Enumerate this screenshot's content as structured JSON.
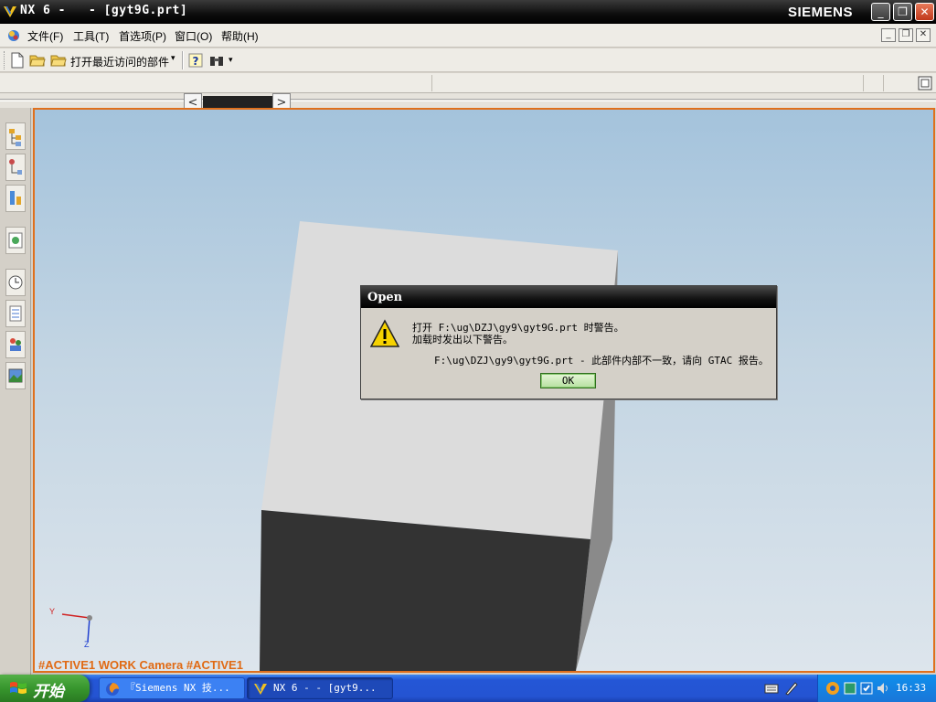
{
  "window": {
    "title": "NX 6 -   - [gyt9G.prt]",
    "brand": "SIEMENS"
  },
  "menu": {
    "items": [
      "文件(F)",
      "工具(T)",
      "首选项(P)",
      "窗口(O)",
      "帮助(H)"
    ]
  },
  "toolbar": {
    "recent_label": "打开最近访问的部件"
  },
  "viewport": {
    "work_view_label": "#ACTIVE1 WORK Camera #ACTIVE1",
    "triad": {
      "y_label": "Y",
      "z_label": "Z"
    }
  },
  "dialog": {
    "title": "Open",
    "line1": "打开 F:\\ug\\DZJ\\gy9\\gyt9G.prt 时警告。",
    "line2": "加载时发出以下警告。",
    "line3": "F:\\ug\\DZJ\\gy9\\gyt9G.prt - 此部件内部不一致，请向 GTAC 报告。",
    "ok_label": "OK"
  },
  "taskbar": {
    "start_label": "开始",
    "tasks": [
      "『Siemens NX 技...",
      "NX 6 -   - [gyt9..."
    ],
    "clock": "16:33"
  },
  "colors": {
    "viewport_border": "#e0701c",
    "work_view_text": "#e06a14",
    "taskbar": "#2454d2",
    "start": "#37962d"
  }
}
